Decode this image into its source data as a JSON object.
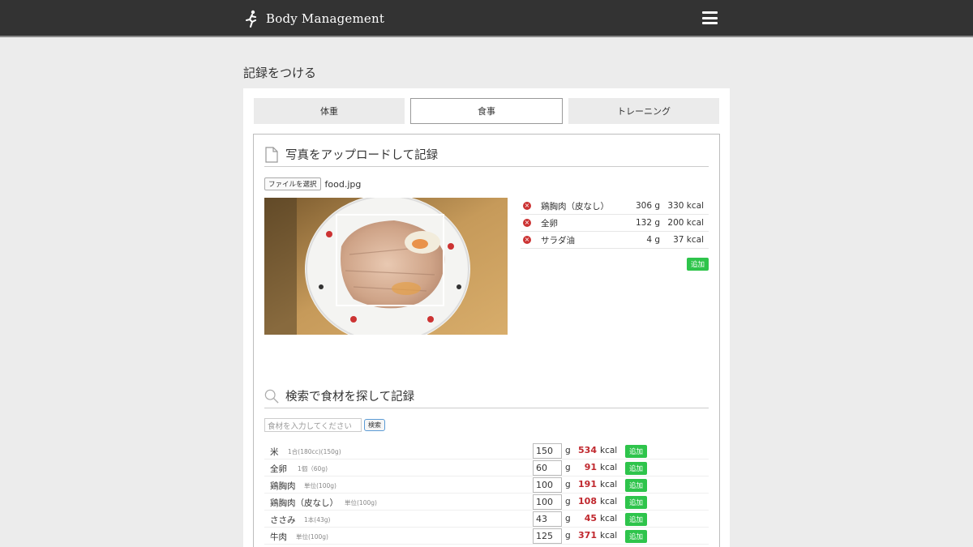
{
  "app": {
    "title": "Body Management"
  },
  "page": {
    "heading": "記録をつける"
  },
  "tabs": [
    {
      "label": "体重",
      "active": false
    },
    {
      "label": "食事",
      "active": true
    },
    {
      "label": "トレーニング",
      "active": false
    }
  ],
  "upload": {
    "title": "写真をアップロードして記録",
    "choose_label": "ファイルを選択",
    "file_name": "food.jpg"
  },
  "detected": {
    "items": [
      {
        "name": "鶏胸肉（皮なし）",
        "grams": "306 g",
        "kcal": "330 kcal"
      },
      {
        "name": "全卵",
        "grams": "132 g",
        "kcal": "200 kcal"
      },
      {
        "name": "サラダ油",
        "grams": "4 g",
        "kcal": "37 kcal"
      }
    ],
    "add_label": "追加"
  },
  "search": {
    "title": "検索で食材を探して記録",
    "placeholder": "食材を入力してください",
    "button_label": "検索"
  },
  "foods": [
    {
      "name": "米",
      "unit": "1合(180cc)(150g)",
      "qty": "150",
      "g": "g",
      "kcal": "534",
      "kcal_unit": "kcal",
      "add": "追加"
    },
    {
      "name": "全卵",
      "unit": "1個（60g)",
      "qty": "60",
      "g": "g",
      "kcal": "91",
      "kcal_unit": "kcal",
      "add": "追加"
    },
    {
      "name": "鶏胸肉",
      "unit": "単位(100g)",
      "qty": "100",
      "g": "g",
      "kcal": "191",
      "kcal_unit": "kcal",
      "add": "追加"
    },
    {
      "name": "鶏胸肉（皮なし）",
      "unit": "単位(100g)",
      "qty": "100",
      "g": "g",
      "kcal": "108",
      "kcal_unit": "kcal",
      "add": "追加"
    },
    {
      "name": "ささみ",
      "unit": "1本(43g)",
      "qty": "43",
      "g": "g",
      "kcal": "45",
      "kcal_unit": "kcal",
      "add": "追加"
    },
    {
      "name": "牛肉",
      "unit": "単位(100g)",
      "qty": "125",
      "g": "g",
      "kcal": "371",
      "kcal_unit": "kcal",
      "add": "追加"
    }
  ],
  "colors": {
    "header_bg": "#333333",
    "accent_green": "#2ec44b",
    "kcal_red": "#c0272d",
    "delete_red": "#cc3333"
  }
}
